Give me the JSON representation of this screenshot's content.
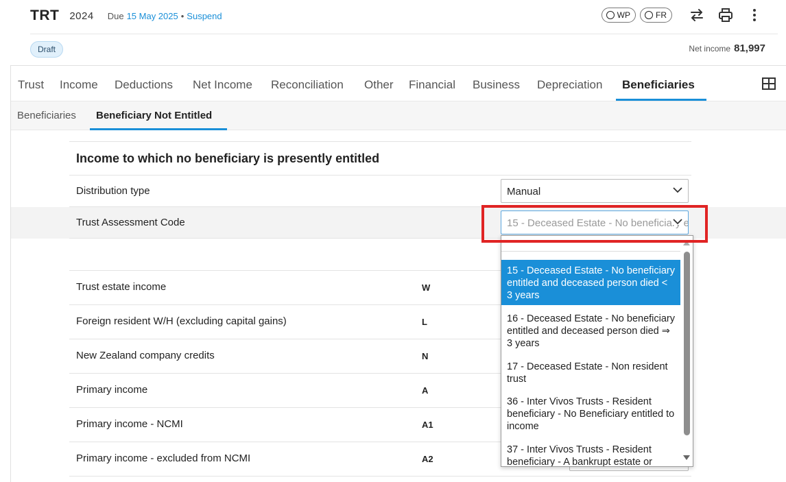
{
  "header": {
    "app_code": "TRT",
    "year": "2024",
    "due_label": "Due",
    "due_date": "15 May 2025",
    "bullet": "•",
    "suspend_label": "Suspend",
    "wp_label": "WP",
    "fr_label": "FR",
    "status_badge": "Draft",
    "net_income_label": "Net income",
    "net_income_value": "81,997"
  },
  "tabs": [
    {
      "label": "Trust"
    },
    {
      "label": "Income"
    },
    {
      "label": "Deductions"
    },
    {
      "label": "Net Income"
    },
    {
      "label": "Reconciliation"
    },
    {
      "label": "Other"
    },
    {
      "label": "Financial"
    },
    {
      "label": "Business"
    },
    {
      "label": "Depreciation"
    },
    {
      "label": "Beneficiaries",
      "active": true
    }
  ],
  "subtabs": [
    {
      "label": "Beneficiaries"
    },
    {
      "label": "Beneficiary Not Entitled",
      "active": true
    }
  ],
  "section": {
    "title": "Income to which no beneficiary is presently entitled"
  },
  "fields": {
    "distribution_type": {
      "label": "Distribution type",
      "value": "Manual"
    },
    "trust_assessment_code": {
      "label": "Trust Assessment Code",
      "value": "15 - Deceased Estate - No beneficiary entitled and deceased person died < 3 years"
    }
  },
  "income_rows": [
    {
      "label": "Trust estate income",
      "code": "W"
    },
    {
      "label": "Foreign resident W/H (excluding capital gains)",
      "code": "L"
    },
    {
      "label": "New Zealand company credits",
      "code": "N"
    },
    {
      "label": "Primary income",
      "code": "A"
    },
    {
      "label": "Primary income - NCMI",
      "code": "A1"
    },
    {
      "label": "Primary income - excluded from NCMI",
      "code": "A2"
    }
  ],
  "dropdown_options": [
    {
      "label": "15 - Deceased Estate - No beneficiary entitled and deceased person died < 3 years",
      "selected": true
    },
    {
      "label": "16 - Deceased Estate - No beneficiary entitled and deceased person died ⇒ 3 years"
    },
    {
      "label": "17 - Deceased Estate - Non resident trust"
    },
    {
      "label": "36 - Inter Vivos Trusts - Resident beneficiary - No Beneficiary entitled to income"
    },
    {
      "label": "37 - Inter Vivos Trusts - Resident beneficiary - A bankrupt estate or"
    }
  ],
  "colors": {
    "accent": "#1a8fd8",
    "highlight_box": "#e02424"
  },
  "icons": {
    "swap": "swap-arrows-icon",
    "print": "printer-icon",
    "more": "more-vertical-icon",
    "grid": "grid-layout-icon",
    "chevron": "chevron-down-icon"
  }
}
